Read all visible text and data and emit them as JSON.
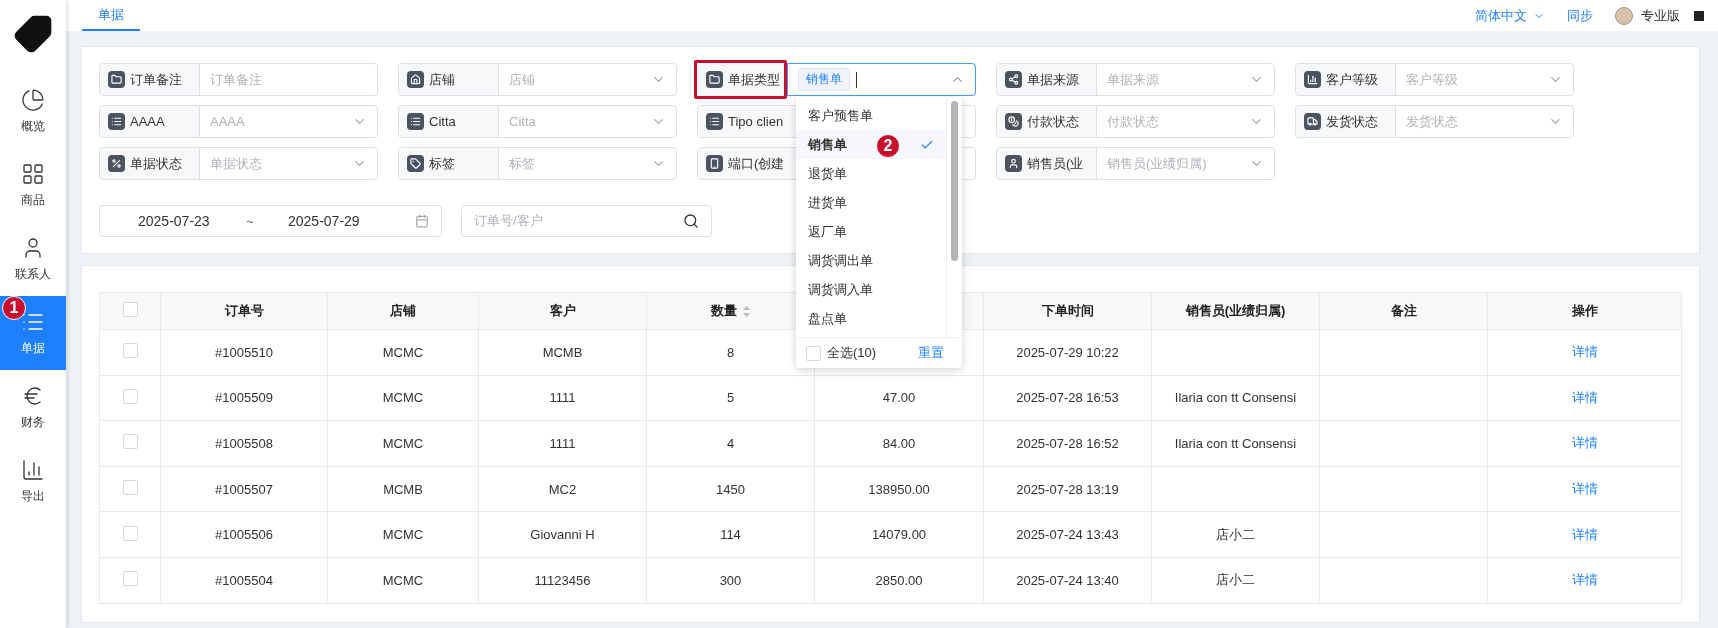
{
  "sidebar": {
    "items": [
      {
        "label": "概览",
        "selected": false
      },
      {
        "label": "商品",
        "selected": false
      },
      {
        "label": "联系人",
        "selected": false
      },
      {
        "label": "单据",
        "selected": true,
        "marker": "1"
      },
      {
        "label": "财务",
        "selected": false
      },
      {
        "label": "导出",
        "selected": false
      }
    ]
  },
  "topbar": {
    "tabs": [
      {
        "label": "单据",
        "selected": true
      }
    ],
    "language": "简体中文",
    "sync": "同步",
    "plan": "专业版"
  },
  "filters": [
    {
      "kind": "input",
      "label": "订单备注",
      "placeholder": "订单备注"
    },
    {
      "kind": "select",
      "label": "店铺",
      "placeholder": "店铺"
    },
    {
      "kind": "select",
      "label": "单据类型",
      "highlighted": true,
      "open": true,
      "tags": [
        "销售单"
      ]
    },
    {
      "kind": "select",
      "label": "单据来源",
      "placeholder": "单据来源"
    },
    {
      "kind": "select",
      "label": "客户等级",
      "placeholder": "客户等级"
    },
    {
      "kind": "select",
      "label": "AAAA",
      "placeholder": "AAAA"
    },
    {
      "kind": "select",
      "label": "Citta",
      "placeholder": "Citta"
    },
    {
      "kind": "select",
      "label": "Tipo clien"
    },
    {
      "kind": "select",
      "label": "付款状态",
      "placeholder": "付款状态"
    },
    {
      "kind": "select",
      "label": "发货状态",
      "placeholder": "发货状态"
    },
    {
      "kind": "select",
      "label": "单据状态",
      "placeholder": "单据状态"
    },
    {
      "kind": "select",
      "label": "标签",
      "placeholder": "标签"
    },
    {
      "kind": "select",
      "label": "端口(创建"
    },
    {
      "kind": "select",
      "label": "销售员(业",
      "placeholder": "销售员(业绩归属)"
    }
  ],
  "dropdown": {
    "options": [
      {
        "label": "客户预售单",
        "selected": false
      },
      {
        "label": "销售单",
        "selected": true,
        "marker": "2"
      },
      {
        "label": "退货单",
        "selected": false
      },
      {
        "label": "进货单",
        "selected": false
      },
      {
        "label": "返厂单",
        "selected": false
      },
      {
        "label": "调货调出单",
        "selected": false
      },
      {
        "label": "调货调入单",
        "selected": false
      },
      {
        "label": "盘点单",
        "selected": false
      }
    ],
    "select_all": {
      "label": "全选(10)",
      "checked": false
    },
    "reset": "重置"
  },
  "date_range": {
    "start": "2025-07-23",
    "separator": "~",
    "end": "2025-07-29"
  },
  "search": {
    "placeholder": "订单号/客户"
  },
  "table": {
    "header_checked": false,
    "columns": [
      {
        "label": "订单号"
      },
      {
        "label": "店铺"
      },
      {
        "label": "客户"
      },
      {
        "label": "数量",
        "sortable": true
      },
      {},
      {
        "label": "下单时间"
      },
      {
        "label": "销售员(业绩归属)"
      },
      {
        "label": "备注"
      },
      {
        "label": "操作"
      }
    ],
    "rows": [
      {
        "checked": false,
        "cells": [
          "#1005510",
          "MCMC",
          "MCMB",
          "8",
          null,
          "2025-07-29 10:22",
          null,
          null,
          "详情"
        ]
      },
      {
        "checked": false,
        "cells": [
          "#1005509",
          "MCMC",
          "1111",
          "5",
          "47.00",
          "2025-07-28 16:53",
          "Ilaria con tt Consensi",
          null,
          "详情"
        ]
      },
      {
        "checked": false,
        "cells": [
          "#1005508",
          "MCMC",
          "1111",
          "4",
          "84.00",
          "2025-07-28 16:52",
          "Ilaria con tt Consensi",
          null,
          "详情"
        ]
      },
      {
        "checked": false,
        "cells": [
          "#1005507",
          "MCMB",
          "MC2",
          "1450",
          "138950.00",
          "2025-07-28 13:19",
          null,
          null,
          "详情"
        ]
      },
      {
        "checked": false,
        "cells": [
          "#1005506",
          "MCMC",
          "Giovanni H",
          "114",
          "14079.00",
          "2025-07-24 13:43",
          "店小二",
          null,
          "详情"
        ]
      },
      {
        "checked": false,
        "cells": [
          "#1005504",
          "MCMC",
          "11123456",
          "300",
          "2850.00",
          "2025-07-24 13:40",
          "店小二",
          null,
          "详情"
        ]
      }
    ]
  }
}
